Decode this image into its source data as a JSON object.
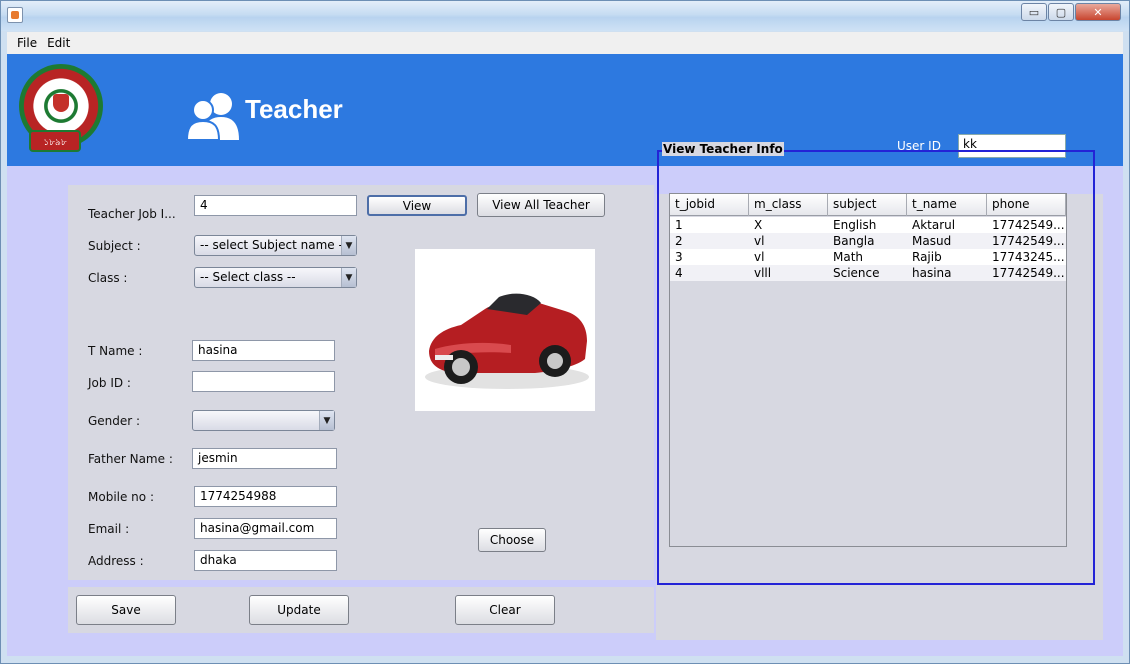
{
  "window": {
    "minimize": "▭",
    "maximize": "▢",
    "close": "✕"
  },
  "menu": {
    "items": [
      "File",
      "Edit"
    ]
  },
  "header": {
    "title": "Teacher",
    "user_id_label": "User ID",
    "user_id_value": "kk",
    "logo_text": "১৮৯৮"
  },
  "form": {
    "job_id_label": "Teacher Job I...",
    "job_id_value": "4",
    "view_button": "View",
    "view_all_button": "View All  Teacher",
    "subject_label": "Subject   :",
    "subject_value": "-- select Subject name --",
    "class_label": "Class :",
    "class_value": "-- Select class --",
    "t_name_label": "T  Name :",
    "t_name_value": "hasina",
    "job_id2_label": "Job  ID  :",
    "job_id2_value": "",
    "gender_label": "Gender :",
    "gender_value": "",
    "father_label": "Father Name :",
    "father_value": "jesmin",
    "mobile_label": "Mobile no :",
    "mobile_value": "1774254988",
    "email_label": "Email  :",
    "email_value": "hasina@gmail.com",
    "address_label": "Address :",
    "address_value": "dhaka",
    "choose_button": "Choose"
  },
  "actions": {
    "save": "Save",
    "update": "Update",
    "clear": "Clear"
  },
  "teacher_info": {
    "legend": "View Teacher Info",
    "columns": [
      "t_jobid",
      "m_class",
      "subject",
      "t_name",
      "phone"
    ],
    "rows": [
      [
        "1",
        "X",
        "English",
        "Aktarul",
        "17742549..."
      ],
      [
        "2",
        "vl",
        "Bangla",
        "Masud",
        "17742549..."
      ],
      [
        "3",
        "vl",
        "Math",
        "Rajib",
        "17743245..."
      ],
      [
        "4",
        "vlll",
        "Science",
        "hasina",
        "17742549..."
      ]
    ]
  },
  "colors": {
    "header_bg": "#2d79e0",
    "client_bg": "#cccdfa",
    "panel_bg": "#d7d8e1",
    "legend_border": "#2323d6"
  }
}
